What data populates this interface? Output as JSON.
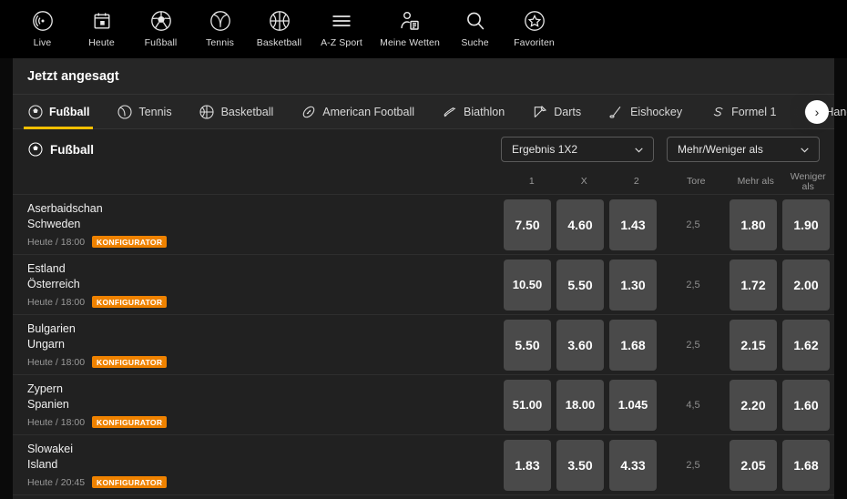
{
  "topnav": {
    "items": [
      {
        "label": "Live",
        "icon": "live-signal-icon"
      },
      {
        "label": "Heute",
        "icon": "calendar-icon"
      },
      {
        "label": "Fußball",
        "icon": "soccer-ball-icon"
      },
      {
        "label": "Tennis",
        "icon": "tennis-ball-icon"
      },
      {
        "label": "Basketball",
        "icon": "basketball-icon"
      },
      {
        "label": "A-Z Sport",
        "icon": "hamburger-menu-icon"
      },
      {
        "label": "Meine Wetten",
        "icon": "user-bet-slip-icon"
      },
      {
        "label": "Suche",
        "icon": "search-icon"
      },
      {
        "label": "Favoriten",
        "icon": "star-circle-icon"
      }
    ]
  },
  "headline": {
    "title": "Jetzt angesagt"
  },
  "tabs": {
    "items": [
      {
        "label": "Fußball",
        "icon": "soccer-ball-icon",
        "active": true
      },
      {
        "label": "Tennis",
        "icon": "tennis-ball-icon",
        "active": false
      },
      {
        "label": "Basketball",
        "icon": "basketball-icon",
        "active": false
      },
      {
        "label": "American Football",
        "icon": "american-football-icon",
        "active": false
      },
      {
        "label": "Biathlon",
        "icon": "biathlon-ski-icon",
        "active": false
      },
      {
        "label": "Darts",
        "icon": "darts-icon",
        "active": false
      },
      {
        "label": "Eishockey",
        "icon": "ice-hockey-icon",
        "active": false
      },
      {
        "label": "Formel 1",
        "icon": "formula-one-icon",
        "active": false
      },
      {
        "label": "Handball",
        "icon": "handball-icon",
        "active": false
      }
    ],
    "next_arrow": "›",
    "active_underline_color": "#ffc000"
  },
  "section": {
    "title": "Fußball",
    "icon": "soccer-ball-icon",
    "dropdown_1": {
      "label": "Ergebnis 1X2",
      "chevron": "chevron-down-icon"
    },
    "dropdown_2": {
      "label": "Mehr/Weniger als",
      "chevron": "chevron-down-icon"
    }
  },
  "columns": {
    "c1": "1",
    "cX": "X",
    "c2": "2",
    "tore": "Tore",
    "mehr": "Mehr als",
    "weniger_line1": "Weniger",
    "weniger_line2": "als"
  },
  "badge_color": "#ef8200",
  "matches": [
    {
      "home": "Aserbaidschan",
      "away": "Schweden",
      "time": "Heute / 18:00",
      "badge": "KONFIGURATOR",
      "odds": {
        "1": "7.50",
        "X": "4.60",
        "2": "1.43"
      },
      "tore": "2,5",
      "mehr": "1.80",
      "weniger": "1.90"
    },
    {
      "home": "Estland",
      "away": "Österreich",
      "time": "Heute / 18:00",
      "badge": "KONFIGURATOR",
      "odds": {
        "1": "10.50",
        "X": "5.50",
        "2": "1.30"
      },
      "tore": "2,5",
      "mehr": "1.72",
      "weniger": "2.00"
    },
    {
      "home": "Bulgarien",
      "away": "Ungarn",
      "time": "Heute / 18:00",
      "badge": "KONFIGURATOR",
      "odds": {
        "1": "5.50",
        "X": "3.60",
        "2": "1.68"
      },
      "tore": "2,5",
      "mehr": "2.15",
      "weniger": "1.62"
    },
    {
      "home": "Zypern",
      "away": "Spanien",
      "time": "Heute / 18:00",
      "badge": "KONFIGURATOR",
      "odds": {
        "1": "51.00",
        "X": "18.00",
        "2": "1.045"
      },
      "tore": "4,5",
      "mehr": "2.20",
      "weniger": "1.60"
    },
    {
      "home": "Slowakei",
      "away": "Island",
      "time": "Heute / 20:45",
      "badge": "KONFIGURATOR",
      "odds": {
        "1": "1.83",
        "X": "3.50",
        "2": "4.33"
      },
      "tore": "2,5",
      "mehr": "2.05",
      "weniger": "1.68"
    }
  ]
}
